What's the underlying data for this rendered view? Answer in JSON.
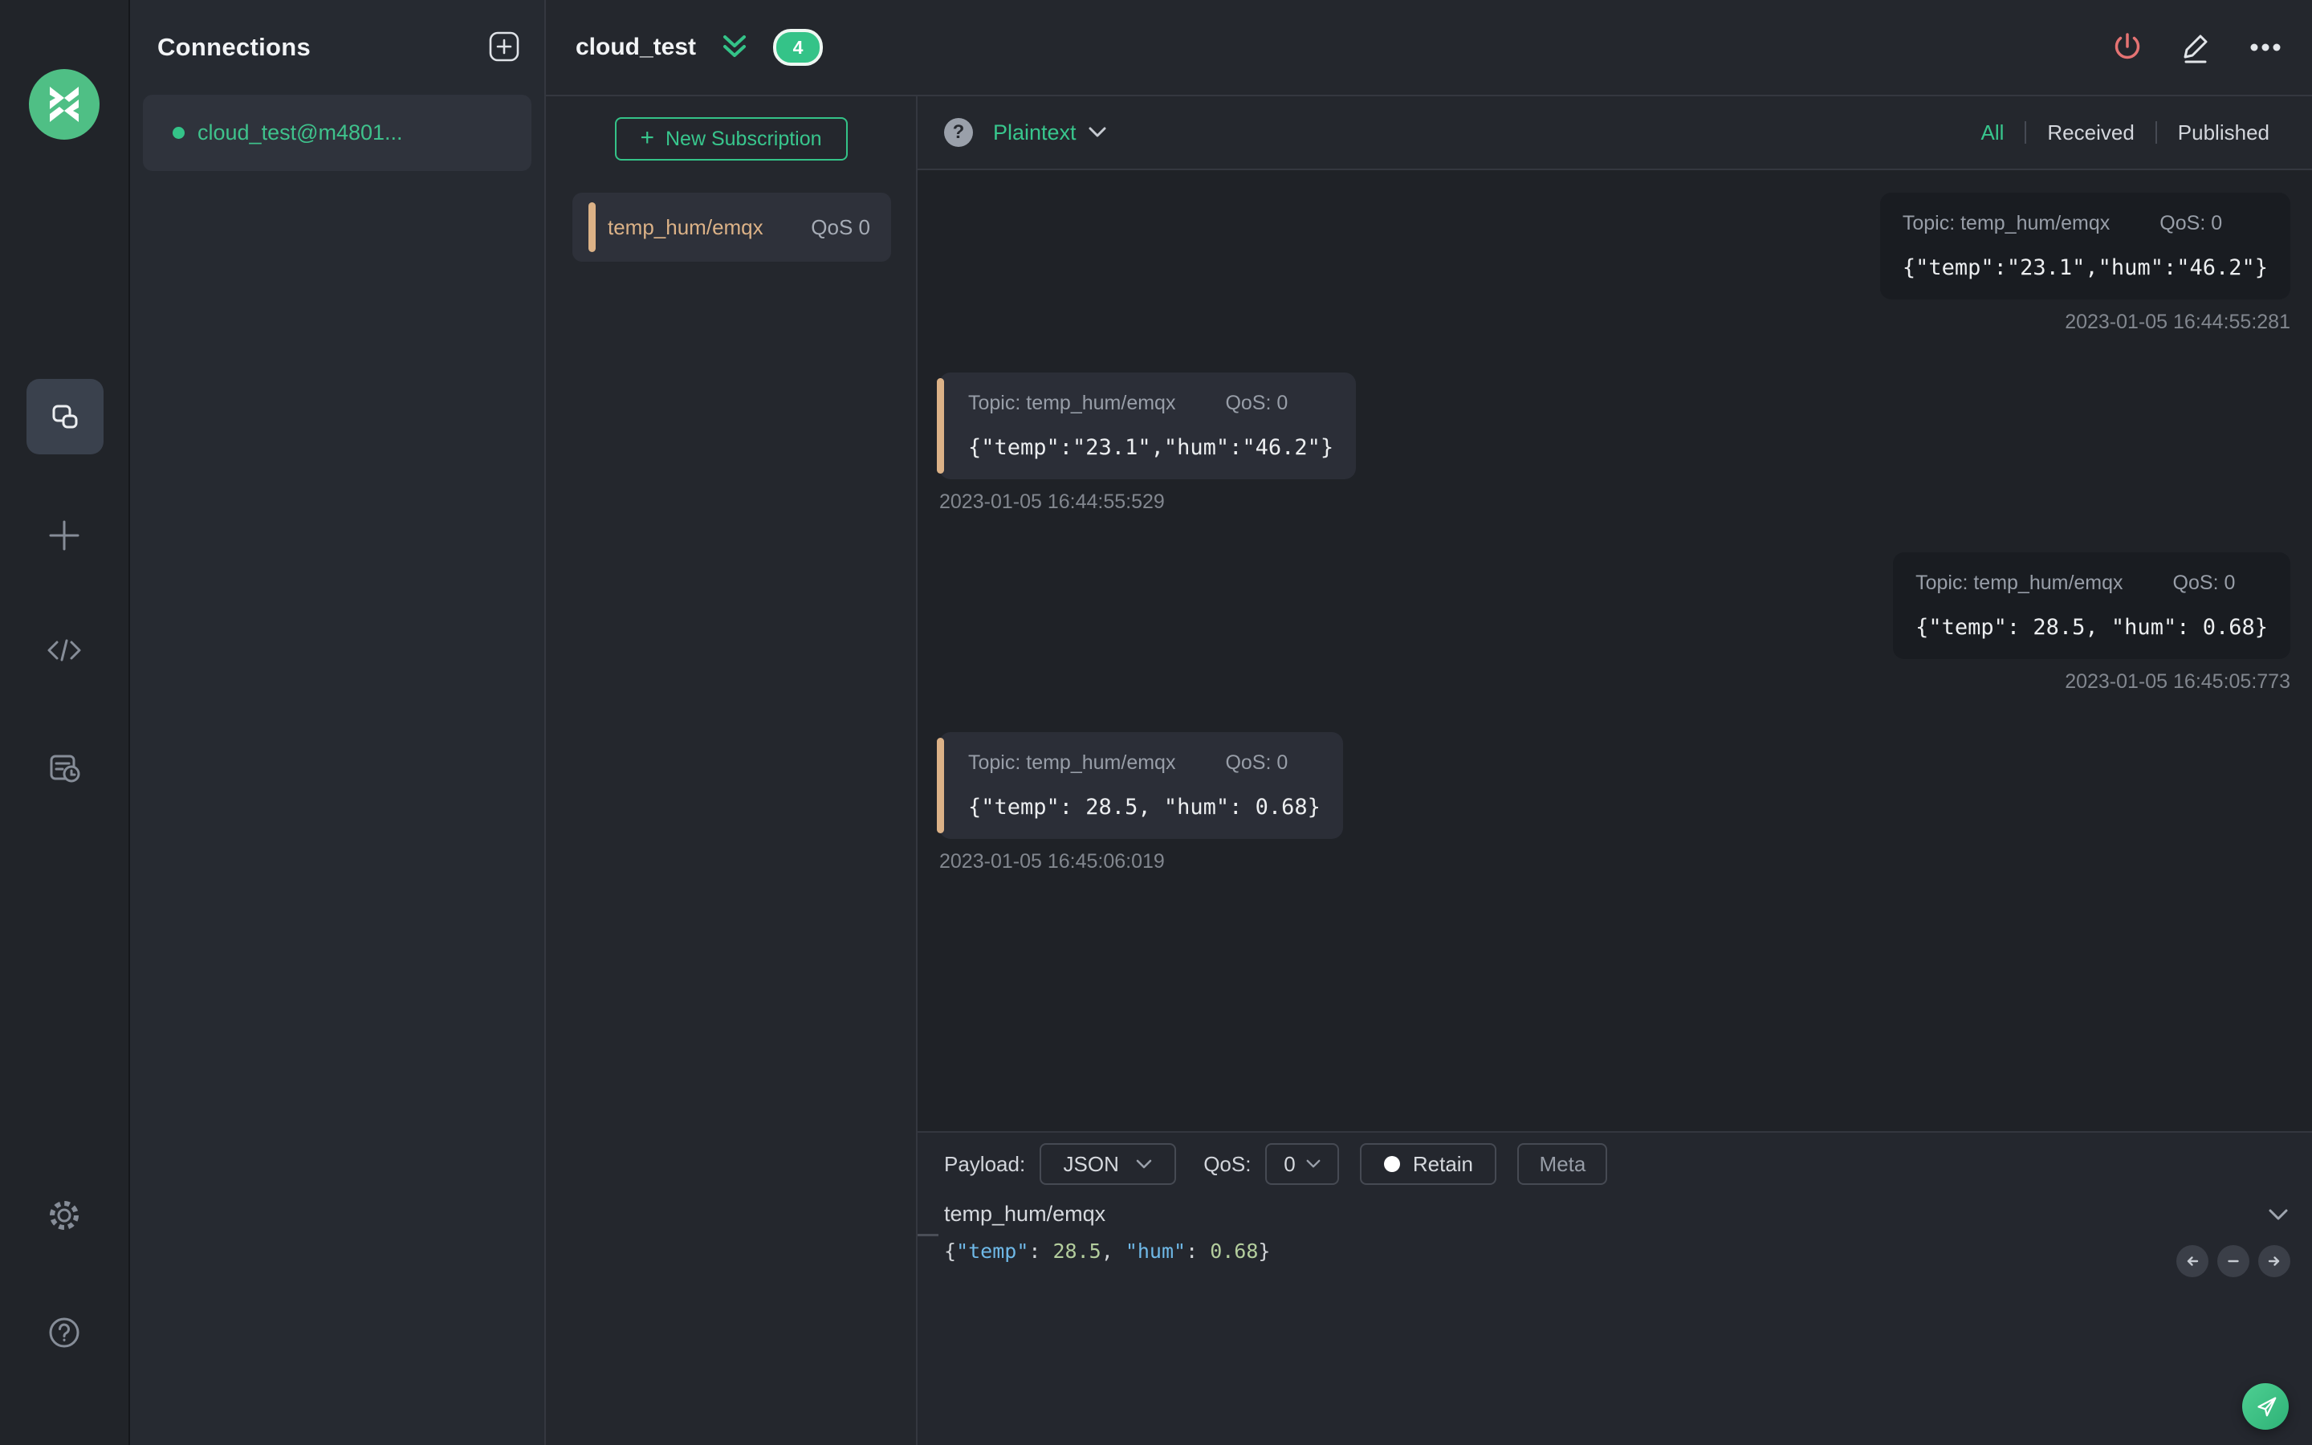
{
  "colors": {
    "accent_green": "#34c388",
    "subscription_tan": "#dcb287",
    "danger_red": "#e57373",
    "syntax_key_blue": "#6fb9e8",
    "syntax_number_green": "#b3cd9d"
  },
  "sidebar": {
    "icons": [
      "mqttx-logo",
      "connections",
      "new-connection",
      "script",
      "log",
      "settings",
      "help"
    ]
  },
  "connections": {
    "title": "Connections",
    "items": [
      {
        "label": "cloud_test@m4801...",
        "status_color": "#34c388"
      }
    ]
  },
  "topbar": {
    "title": "cloud_test",
    "badge_count": "4"
  },
  "subscriptions": {
    "new_button_label": "New Subscription",
    "new_button_plus": "+",
    "items": [
      {
        "topic": "temp_hum/emqx",
        "qos": "QoS 0"
      }
    ]
  },
  "messages_header": {
    "help_glyph": "?",
    "format": "Plaintext",
    "filters": [
      {
        "label": "All",
        "active": true
      },
      {
        "label": "Received",
        "active": false
      },
      {
        "label": "Published",
        "active": false
      }
    ]
  },
  "messages": [
    {
      "side": "right",
      "topic": "Topic: temp_hum/emqx",
      "qos": "QoS: 0",
      "payload": "{\"temp\":\"23.1\",\"hum\":\"46.2\"}",
      "timestamp": "2023-01-05 16:44:55:281"
    },
    {
      "side": "left",
      "topic": "Topic: temp_hum/emqx",
      "qos": "QoS: 0",
      "payload": "{\"temp\":\"23.1\",\"hum\":\"46.2\"}",
      "timestamp": "2023-01-05 16:44:55:529"
    },
    {
      "side": "right",
      "topic": "Topic: temp_hum/emqx",
      "qos": "QoS: 0",
      "payload": "{\"temp\": 28.5, \"hum\": 0.68}",
      "timestamp": "2023-01-05 16:45:05:773"
    },
    {
      "side": "left",
      "topic": "Topic: temp_hum/emqx",
      "qos": "QoS: 0",
      "payload": "{\"temp\": 28.5, \"hum\": 0.68}",
      "timestamp": "2023-01-05 16:45:06:019"
    }
  ],
  "publish": {
    "payload_label": "Payload:",
    "format_value": "JSON",
    "qos_label": "QoS:",
    "qos_value": "0",
    "retain_label": "Retain",
    "meta_label": "Meta",
    "topic_value": "temp_hum/emqx",
    "editor": {
      "brace_open": "{",
      "key1": "\"temp\"",
      "colon1": ": ",
      "val1": "28.5",
      "comma1": ", ",
      "key2": "\"hum\"",
      "colon2": ": ",
      "val2": "0.68",
      "brace_close": "}"
    }
  }
}
